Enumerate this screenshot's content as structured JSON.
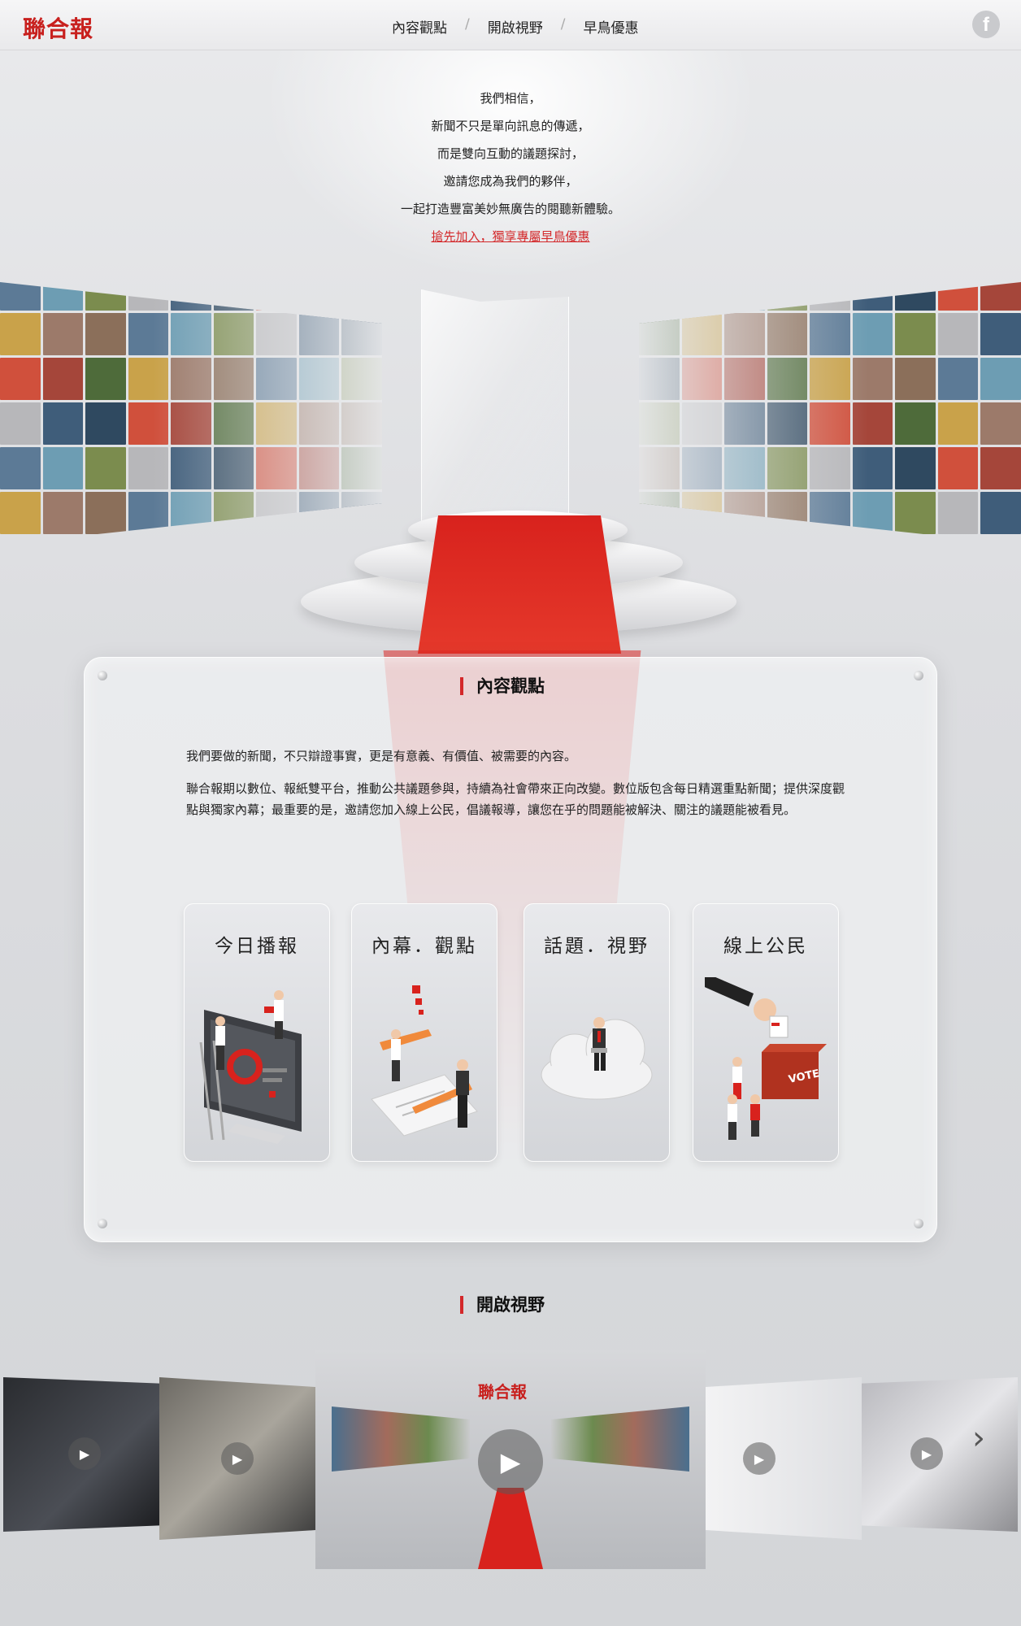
{
  "header": {
    "logo": "聯合報",
    "nav": [
      "內容觀點",
      "開啟視野",
      "早鳥優惠"
    ],
    "facebook_icon": "f"
  },
  "intro": {
    "lines": [
      "我們相信，",
      "新聞不只是單向訊息的傳遞，",
      "而是雙向互動的議題探討，",
      "邀請您成為我們的夥伴，",
      "一起打造豐富美妙無廣告的閱聽新體驗。"
    ],
    "cta": "搶先加入，獨享專屬早鳥優惠"
  },
  "content_section": {
    "title": "內容觀點",
    "paragraphs": [
      "我們要做的新聞，不只辯證事實，更是有意義、有價值、被需要的內容。",
      "聯合報期以數位、報紙雙平台，推動公共議題參與，持續為社會帶來正向改變。數位版包含每日精選重點新聞；提供深度觀點與獨家內幕；最重要的是，邀請您加入線上公民，倡議報導，讓您在乎的問題能被解決、關注的議題能被看見。"
    ],
    "cards": [
      {
        "title": "今日播報",
        "icon": "broadcast-illustration"
      },
      {
        "title": "內幕．觀點",
        "icon": "pencil-illustration"
      },
      {
        "title": "話題．視野",
        "icon": "cloud-illustration"
      },
      {
        "title": "線上公民",
        "icon": "vote-illustration"
      }
    ]
  },
  "vision_section": {
    "title": "開啟視野",
    "featured_logo": "聯合報",
    "videos": [
      "writing-video",
      "interview-video",
      "featured-video",
      "join-video",
      "headline-video"
    ]
  },
  "colors": {
    "brand_red": "#d3282a",
    "background": "#dcdde0"
  }
}
